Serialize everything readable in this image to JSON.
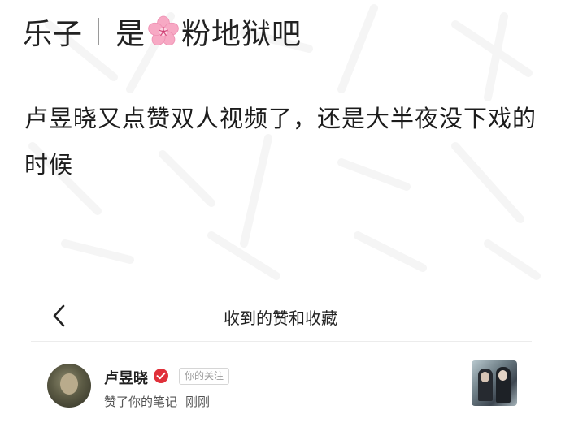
{
  "header": {
    "author": "乐子",
    "title_prefix": "是",
    "flower_icon": "cherry-blossom-icon",
    "title_suffix": "粉地狱吧"
  },
  "post": {
    "text": "卢昱晓又点赞双人视频了，还是大半夜没下戏的时候"
  },
  "screenshot": {
    "nav_title": "收到的赞和收藏",
    "back_icon": "chevron-left-icon",
    "notification": {
      "username": "卢昱晓",
      "verified_icon": "verified-badge-icon",
      "verified_color": "#e0303a",
      "follow_badge": "你的关注",
      "action": "赞了你的笔记",
      "time": "刚刚"
    }
  }
}
